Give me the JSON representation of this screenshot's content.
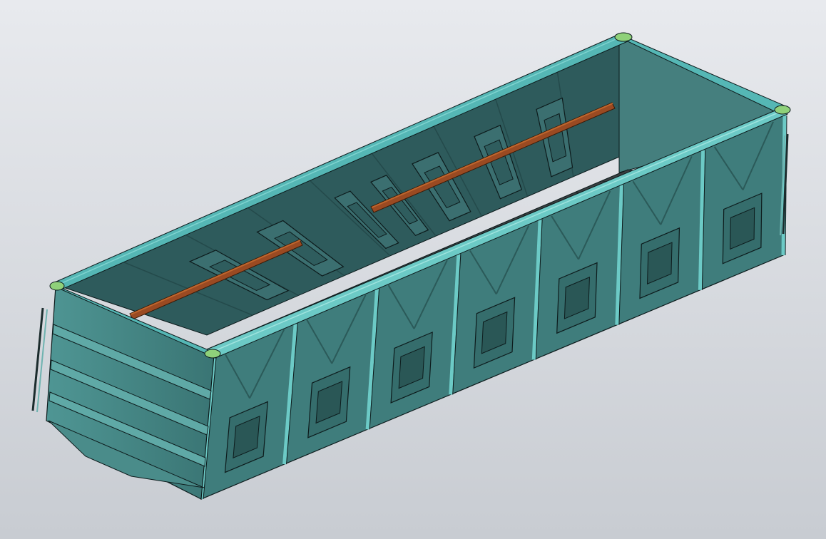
{
  "scene": {
    "subject": "",
    "colors": {
      "background_top": "#e8eaee",
      "background_bottom": "#c8ccd2",
      "body": "#3f7d7c",
      "body_light": "#4f9694",
      "body_dark": "#24504f",
      "interior": "#2e5b5c",
      "interior_dark": "#1f4244",
      "rim": "#55b7b5",
      "rim_light": "#7fd3cf",
      "edge": "#0d1b1c",
      "floor": "#3a3f41",
      "rail": "#9a4a22",
      "rail_light": "#c0672e",
      "corner_cap": "#8fd17a"
    }
  }
}
